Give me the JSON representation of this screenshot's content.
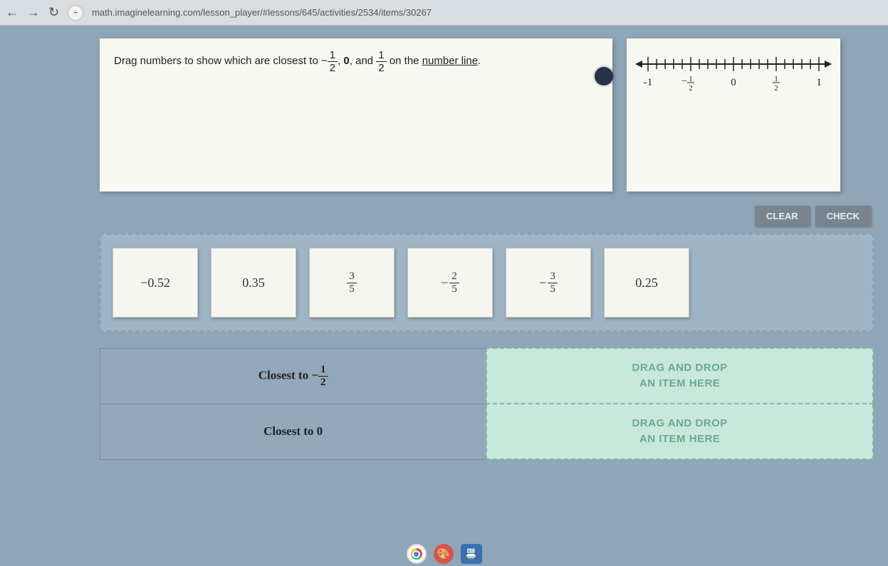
{
  "browser": {
    "url": "math.imaginelearning.com/lesson_player/#lessons/645/activities/2534/items/30267"
  },
  "instruction": {
    "pre": "Drag numbers to show which are closest to ",
    "f1_num": "1",
    "f1_den": "2",
    "mid1": ", ",
    "zero": "0",
    "mid2": ", and ",
    "f2_num": "1",
    "f2_den": "2",
    "post": " on the ",
    "link": "number line",
    "end": "."
  },
  "numberline": {
    "labels": [
      "-1",
      "0",
      "1"
    ],
    "frac_num": "1",
    "frac_den": "2"
  },
  "buttons": {
    "clear": "CLEAR",
    "check": "CHECK"
  },
  "tiles": [
    {
      "type": "decimal",
      "text": "−0.52"
    },
    {
      "type": "decimal",
      "text": "0.35"
    },
    {
      "type": "fraction",
      "sign": "",
      "num": "3",
      "den": "5"
    },
    {
      "type": "fraction",
      "sign": "−",
      "num": "2",
      "den": "5"
    },
    {
      "type": "fraction",
      "sign": "−",
      "num": "3",
      "den": "5"
    },
    {
      "type": "decimal",
      "text": "0.25"
    }
  ],
  "drops": [
    {
      "label_pre": "Closest to −",
      "num": "1",
      "den": "2",
      "label_post": ""
    },
    {
      "label_plain": "Closest to 0"
    }
  ],
  "drop_hint": {
    "l1": "DRAG AND DROP",
    "l2": "AN ITEM HERE"
  }
}
